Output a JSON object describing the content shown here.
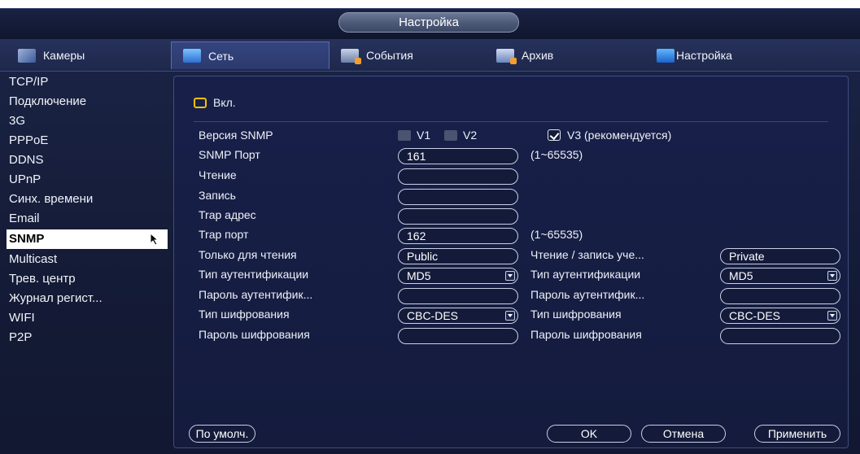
{
  "window": {
    "title": "Настройка"
  },
  "tabs": [
    {
      "label": "Камеры",
      "icon": "camera-icon"
    },
    {
      "label": "Сеть",
      "icon": "network-icon",
      "active": true
    },
    {
      "label": "События",
      "icon": "events-icon"
    },
    {
      "label": "Архив",
      "icon": "archive-icon"
    },
    {
      "label": "Настройка",
      "icon": "settings-icon"
    }
  ],
  "sidebar": {
    "items": [
      {
        "label": "TCP/IP"
      },
      {
        "label": "Подключение"
      },
      {
        "label": "3G"
      },
      {
        "label": "PPPoE"
      },
      {
        "label": "DDNS"
      },
      {
        "label": "UPnP"
      },
      {
        "label": "Синх. времени"
      },
      {
        "label": "Email"
      },
      {
        "label": "SNMP",
        "active": true
      },
      {
        "label": "Multicast"
      },
      {
        "label": "Трев. центр"
      },
      {
        "label": "Журнал регист..."
      },
      {
        "label": "WIFI"
      },
      {
        "label": "P2P"
      }
    ]
  },
  "snmp": {
    "enable_label": "Вкл.",
    "version": {
      "label": "Версия SNMP",
      "v1": "V1",
      "v2": "V2",
      "v3": "V3 (рекомендуется)"
    },
    "port": {
      "label": "SNMP Порт",
      "value": "161",
      "range": "(1~65535)"
    },
    "read": {
      "label": "Чтение",
      "value": ""
    },
    "write": {
      "label": "Запись",
      "value": ""
    },
    "trap_address": {
      "label": "Trap адрес",
      "value": ""
    },
    "trap_port": {
      "label": "Trap порт",
      "value": "162",
      "range": "(1~65535)"
    },
    "read_only": {
      "label": "Только для чтения",
      "value": "Public"
    },
    "read_write": {
      "label": "Чтение / запись уче...",
      "value": "Private"
    },
    "auth_type_left": {
      "label": "Тип аутентификации",
      "value": "MD5"
    },
    "auth_type_right": {
      "label": "Тип аутентификации",
      "value": "MD5"
    },
    "auth_pass_left": {
      "label": "Пароль аутентифик...",
      "value": ""
    },
    "auth_pass_right": {
      "label": "Пароль аутентифик...",
      "value": ""
    },
    "enc_type_left": {
      "label": "Тип шифрования",
      "value": "CBC-DES"
    },
    "enc_type_right": {
      "label": "Тип шифрования",
      "value": "CBC-DES"
    },
    "enc_pass_left": {
      "label": "Пароль шифрования",
      "value": ""
    },
    "enc_pass_right": {
      "label": "Пароль шифрования",
      "value": ""
    }
  },
  "buttons": {
    "default": "По умолч.",
    "ok": "OK",
    "cancel": "Отмена",
    "apply": "Применить"
  },
  "colors": {
    "accent_checkbox": "#f2c200",
    "background": "#141b3d",
    "active_item": "#ffffff"
  }
}
